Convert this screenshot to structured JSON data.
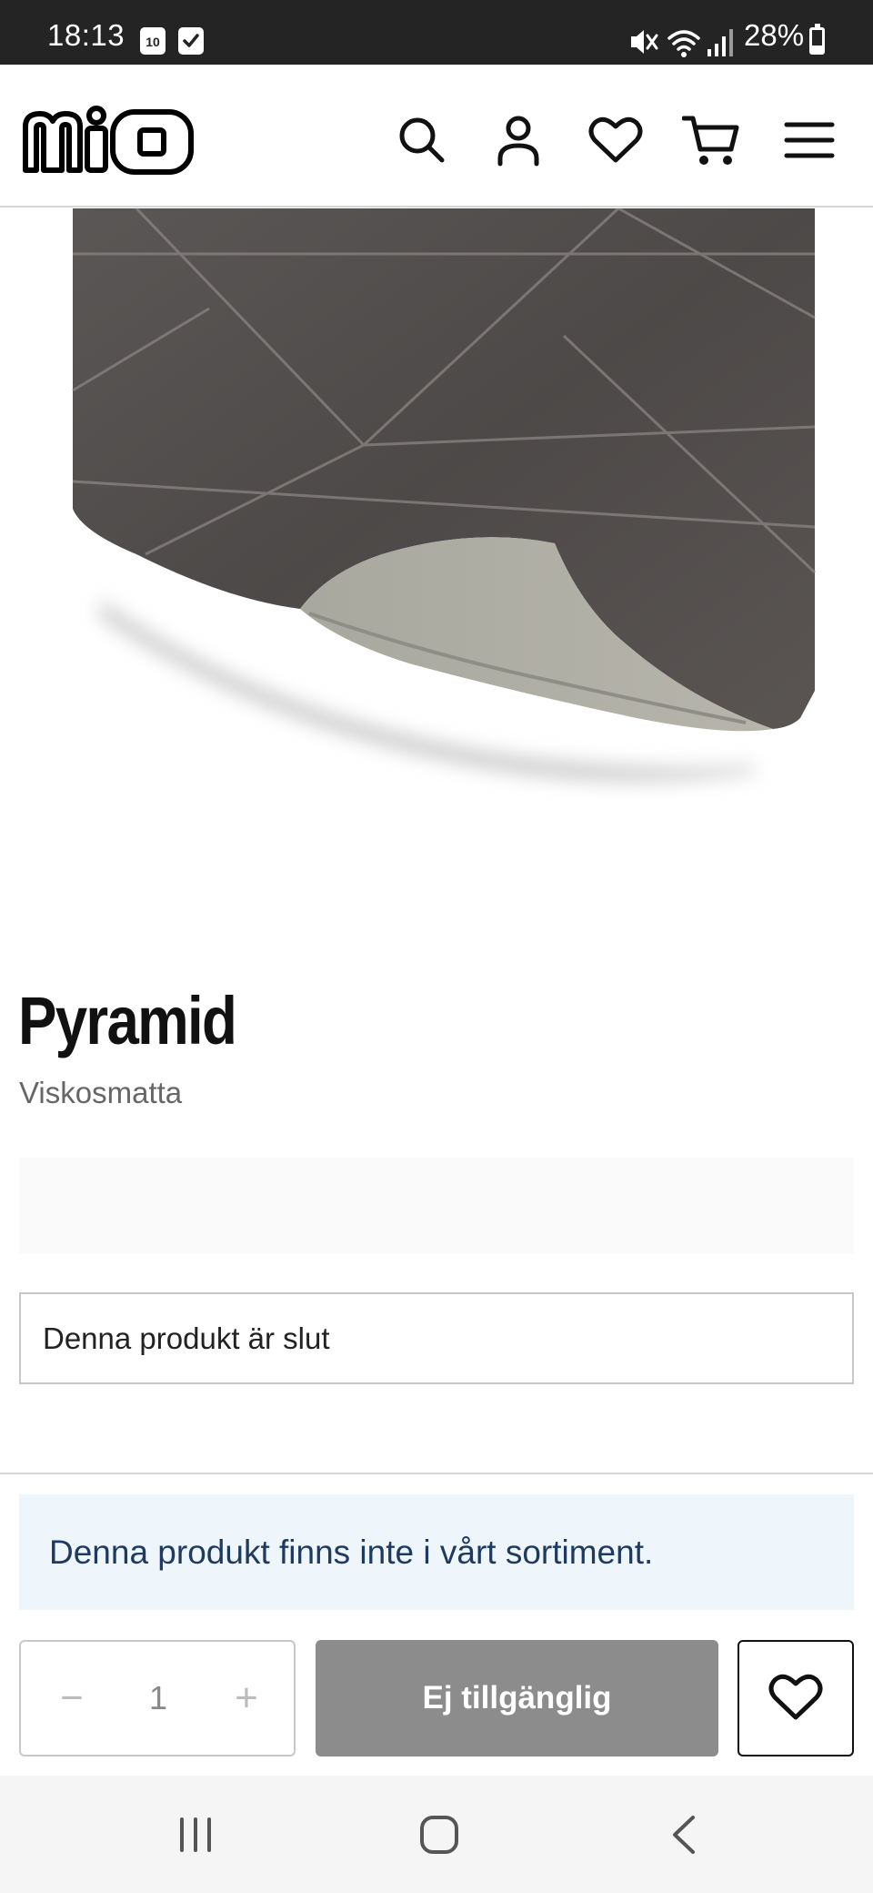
{
  "status_bar": {
    "time": "18:13",
    "calendar_day": "10",
    "battery_percent": "28%",
    "battery_level": 0.28,
    "icons": [
      "calendar-icon",
      "check-icon",
      "mute-icon",
      "wifi-icon",
      "signal-icon",
      "battery-icon"
    ]
  },
  "header": {
    "logo_alt": "mio",
    "icons": [
      "search-icon",
      "account-icon",
      "heart-icon",
      "cart-icon",
      "menu-icon"
    ]
  },
  "product": {
    "title": "Pyramid",
    "subtitle": "Viskosmatta",
    "stock_status": "Denna produkt är slut",
    "info_banner": "Denna produkt finns inte i vårt sortiment."
  },
  "purchase": {
    "quantity": "1",
    "minus_symbol": "−",
    "plus_symbol": "+",
    "add_button_label": "Ej tillgänglig"
  },
  "colors": {
    "brand_dark": "#111111",
    "disabled_button": "#8c8c8c",
    "info_banner_bg": "#eef5fb",
    "info_banner_text": "#1e3a5f"
  }
}
